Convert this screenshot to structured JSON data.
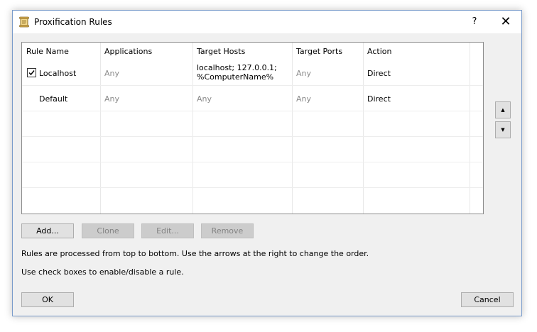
{
  "window": {
    "title": "Proxification Rules",
    "help_label": "?",
    "close_label": "✕"
  },
  "table": {
    "columns": [
      "Rule Name",
      "Applications",
      "Target Hosts",
      "Target Ports",
      "Action"
    ],
    "rows": [
      {
        "checked": true,
        "name": "Localhost",
        "applications": "Any",
        "target_hosts_line1": "localhost; 127.0.0.1;",
        "target_hosts_line2": "%ComputerName%",
        "target_ports": "Any",
        "action": "Direct"
      },
      {
        "checked": null,
        "name": "Default",
        "applications": "Any",
        "target_hosts_line1": "Any",
        "target_ports": "Any",
        "action": "Direct"
      }
    ]
  },
  "order_buttons": {
    "up_label": "▲",
    "down_label": "▼"
  },
  "actions": {
    "add": "Add...",
    "clone": "Clone",
    "edit": "Edit...",
    "remove": "Remove"
  },
  "info": {
    "line1": "Rules are processed from top to bottom. Use the arrows at the right to change the order.",
    "line2": "Use check boxes to enable/disable a rule."
  },
  "footer": {
    "ok": "OK",
    "cancel": "Cancel"
  }
}
